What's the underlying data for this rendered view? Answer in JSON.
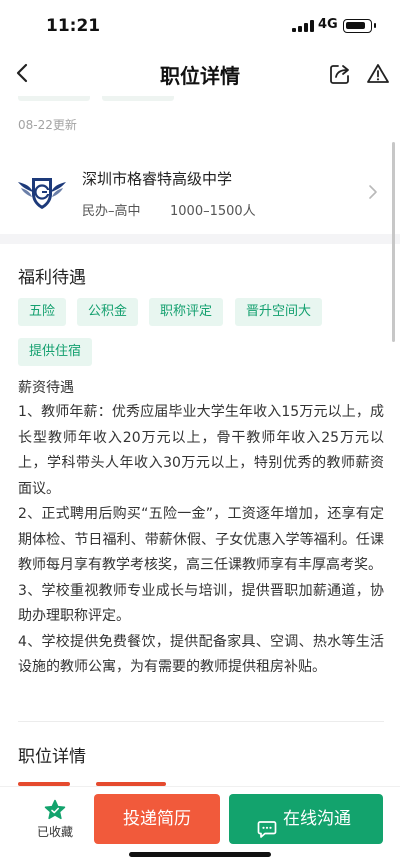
{
  "status_bar": {
    "time": "11:21",
    "network": "4G",
    "battery_level": 0.85
  },
  "nav": {
    "title": "职位详情"
  },
  "update_time": "08-22更新",
  "company": {
    "name": "深圳市格睿特高级中学",
    "type": "民办–高中",
    "size": "1000–1500人"
  },
  "welfare": {
    "title": "福利待遇",
    "tags": [
      "五险",
      "公积金",
      "职称评定",
      "晋升空间大",
      "提供住宿"
    ]
  },
  "salary": {
    "heading": "薪资待遇",
    "paragraphs": [
      "1、教师年薪：优秀应届毕业大学生年收入15万元以上，成长型教师年收入20万元以上，骨干教师年收入25万元以上，学科带头人年收入30万元以上，特别优秀的教师薪资面议。",
      "2、正式聘用后购买“五险一金”，工资逐年增加，还享有定期体检、节日福利、带薪休假、子女优惠入学等福利。任课教师每月享有教学考核奖，高三任课教师享有丰厚高考奖。",
      "3、学校重视教师专业成长与培训，提供晋职加薪通道，协助办理职称评定。",
      "4、学校提供免费餐饮，提供配备家具、空调、热水等生活设施的教师公寓，为有需要的教师提供租房补贴。"
    ]
  },
  "job_detail": {
    "title": "职位详情"
  },
  "bottom_bar": {
    "favorite_label": "已收藏",
    "apply_label": "投递简历",
    "chat_label": "在线沟通"
  },
  "colors": {
    "accent_green": "#13a36d",
    "accent_orange": "#f15a3b",
    "tag_bg": "#e8f6f0"
  },
  "icons": [
    "back-icon",
    "share-icon",
    "report-icon",
    "chevron-right-icon",
    "favorite-icon",
    "chat-icon"
  ]
}
